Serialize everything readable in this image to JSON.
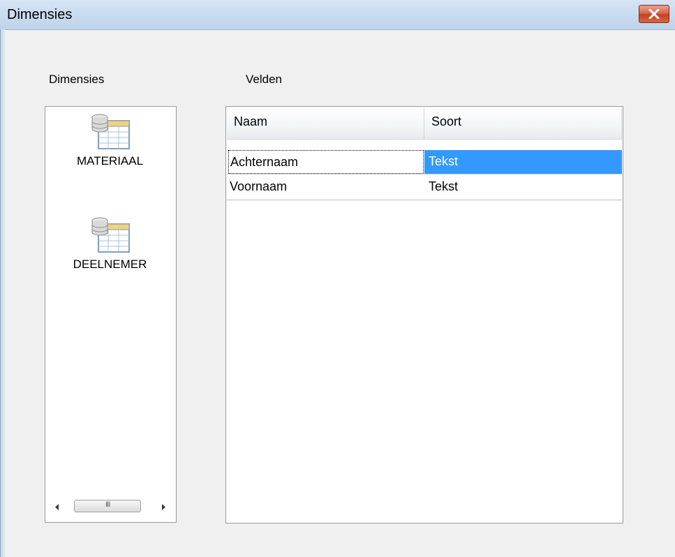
{
  "window": {
    "title": "Dimensies"
  },
  "dimensions": {
    "label": "Dimensies",
    "items": [
      {
        "name": "MATERIAAL",
        "icon": "database-table-icon"
      },
      {
        "name": "DEELNEMER",
        "icon": "database-table-icon"
      }
    ]
  },
  "fields": {
    "label": "Velden",
    "columns": [
      "Naam",
      "Soort"
    ],
    "rows": [
      {
        "naam": "Achternaam",
        "soort": "Tekst",
        "selected": true
      },
      {
        "naam": "Voornaam",
        "soort": "Tekst",
        "selected": false
      }
    ]
  },
  "colors": {
    "selection": "#3399ff",
    "close_button": "#c94a2b"
  }
}
